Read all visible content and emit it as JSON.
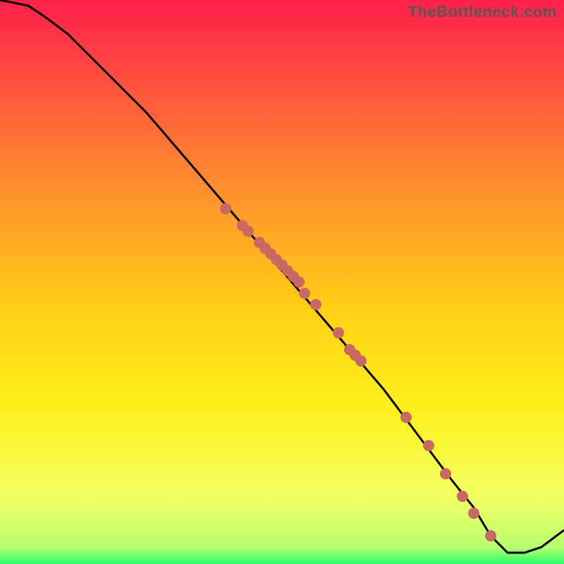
{
  "watermark": "TheBottleneck.com",
  "colors": {
    "gradient_top": "#ff1f4a",
    "gradient_mid_upper": "#ff7e33",
    "gradient_mid": "#ffd016",
    "gradient_mid_lower": "#fff01a",
    "gradient_lower": "#f4ff62",
    "gradient_green": "#2bff6b",
    "line": "#000000",
    "marker": "#c86a62"
  },
  "chart_data": {
    "type": "line",
    "title": "",
    "xlabel": "",
    "ylabel": "",
    "xlim": [
      0,
      100
    ],
    "ylim": [
      0,
      100
    ],
    "grid": false,
    "legend": false,
    "series": [
      {
        "name": "curve",
        "kind": "line",
        "x": [
          0,
          5,
          8,
          12,
          16,
          20,
          26,
          32,
          38,
          44,
          50,
          56,
          62,
          68,
          74,
          80,
          84,
          87,
          90,
          93,
          96,
          100
        ],
        "y": [
          100,
          99,
          97,
          94,
          90,
          86,
          80,
          73,
          66,
          59,
          52,
          45,
          38,
          31,
          23,
          15,
          10,
          5,
          2,
          2,
          3,
          6
        ]
      },
      {
        "name": "markers",
        "kind": "scatter",
        "x": [
          40,
          43,
          44,
          46,
          47,
          48,
          49,
          50,
          51,
          52,
          53,
          54,
          56,
          60,
          62,
          63,
          64,
          72,
          76,
          79,
          82,
          84,
          87
        ],
        "y": [
          63,
          60,
          59,
          57,
          56,
          55,
          54,
          53,
          52,
          51,
          50,
          48,
          46,
          41,
          38,
          37,
          36,
          26,
          21,
          16,
          12,
          9,
          5
        ]
      }
    ]
  }
}
